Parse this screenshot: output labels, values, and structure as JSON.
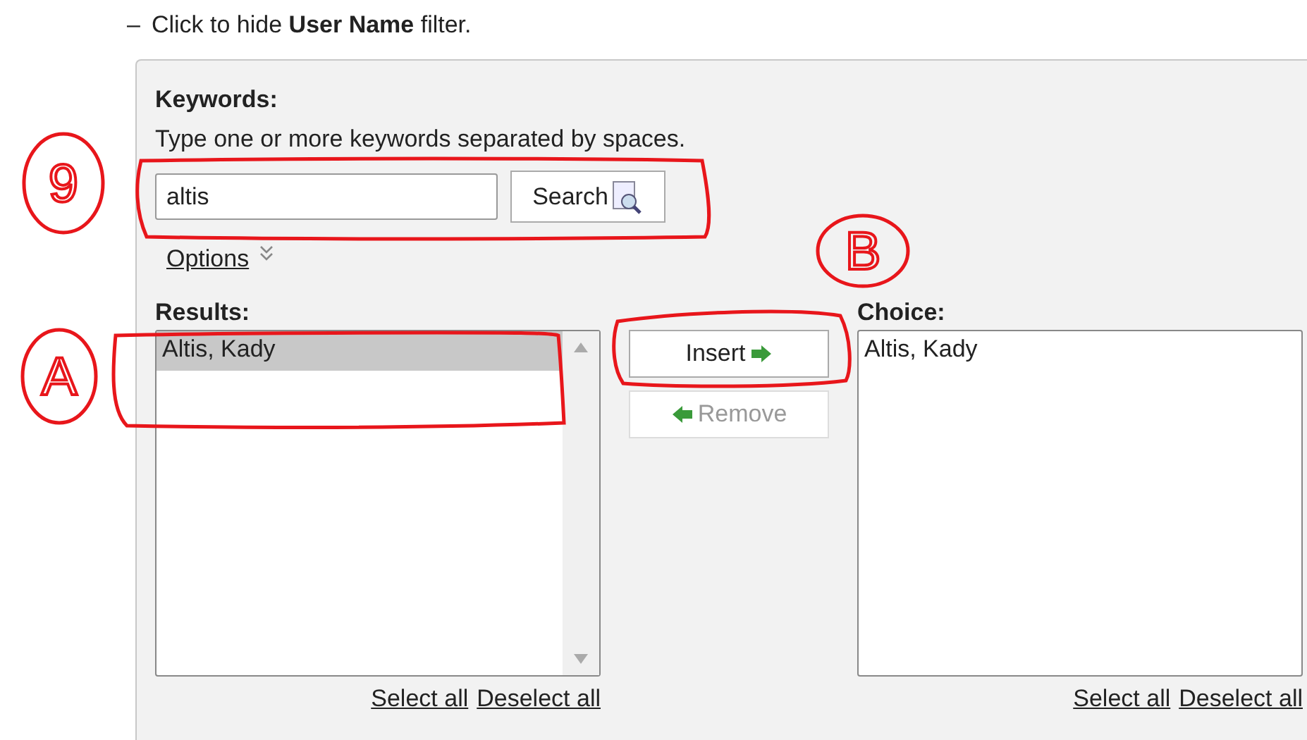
{
  "toggle": {
    "symbol": "–",
    "text": "Click to hide **User Name** filter."
  },
  "keywords": {
    "label": "Keywords:",
    "hint": "Type one or more keywords separated by spaces.",
    "value": "altis",
    "search_button": "Search",
    "options_link": "Options"
  },
  "results": {
    "label": "Results:",
    "items": [
      {
        "text": "Altis, Kady",
        "selected": true
      }
    ],
    "select_all": "Select all",
    "deselect_all": "Deselect all"
  },
  "transfer": {
    "insert": {
      "label": "Insert",
      "disabled": false
    },
    "remove": {
      "label": "Remove",
      "disabled": true
    }
  },
  "choice": {
    "label": "Choice:",
    "items": [
      {
        "text": "Altis, Kady",
        "selected": false
      }
    ],
    "select_all": "Select all",
    "deselect_all": "Deselect all"
  },
  "annotations": [
    {
      "label": "9"
    },
    {
      "label": "A"
    },
    {
      "label": "B"
    }
  ]
}
